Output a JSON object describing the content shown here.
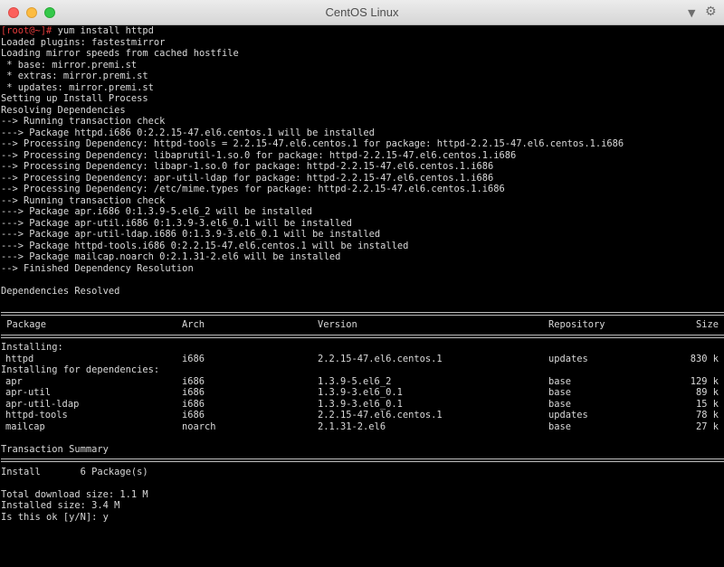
{
  "window": {
    "title": "CentOS Linux"
  },
  "terminal": {
    "prompt": "[root@~]# ",
    "command": "yum install httpd",
    "log": [
      "Loaded plugins: fastestmirror",
      "Loading mirror speeds from cached hostfile",
      " * base: mirror.premi.st",
      " * extras: mirror.premi.st",
      " * updates: mirror.premi.st",
      "Setting up Install Process",
      "Resolving Dependencies",
      "--> Running transaction check",
      "---> Package httpd.i686 0:2.2.15-47.el6.centos.1 will be installed",
      "--> Processing Dependency: httpd-tools = 2.2.15-47.el6.centos.1 for package: httpd-2.2.15-47.el6.centos.1.i686",
      "--> Processing Dependency: libaprutil-1.so.0 for package: httpd-2.2.15-47.el6.centos.1.i686",
      "--> Processing Dependency: libapr-1.so.0 for package: httpd-2.2.15-47.el6.centos.1.i686",
      "--> Processing Dependency: apr-util-ldap for package: httpd-2.2.15-47.el6.centos.1.i686",
      "--> Processing Dependency: /etc/mime.types for package: httpd-2.2.15-47.el6.centos.1.i686",
      "--> Running transaction check",
      "---> Package apr.i686 0:1.3.9-5.el6_2 will be installed",
      "---> Package apr-util.i686 0:1.3.9-3.el6_0.1 will be installed",
      "---> Package apr-util-ldap.i686 0:1.3.9-3.el6_0.1 will be installed",
      "---> Package httpd-tools.i686 0:2.2.15-47.el6.centos.1 will be installed",
      "---> Package mailcap.noarch 0:2.1.31-2.el6 will be installed",
      "--> Finished Dependency Resolution",
      "",
      "Dependencies Resolved",
      ""
    ],
    "table": {
      "headers": {
        "package": " Package",
        "arch": "Arch",
        "version": "Version",
        "repository": "Repository",
        "size": "Size"
      },
      "installing_label": "Installing:",
      "installing": [
        {
          "package": "httpd",
          "arch": "i686",
          "version": "2.2.15-47.el6.centos.1",
          "repository": "updates",
          "size": "830 k"
        }
      ],
      "deps_label": "Installing for dependencies:",
      "deps": [
        {
          "package": "apr",
          "arch": "i686",
          "version": "1.3.9-5.el6_2",
          "repository": "base",
          "size": "129 k"
        },
        {
          "package": "apr-util",
          "arch": "i686",
          "version": "1.3.9-3.el6_0.1",
          "repository": "base",
          "size": "89 k"
        },
        {
          "package": "apr-util-ldap",
          "arch": "i686",
          "version": "1.3.9-3.el6_0.1",
          "repository": "base",
          "size": "15 k"
        },
        {
          "package": "httpd-tools",
          "arch": "i686",
          "version": "2.2.15-47.el6.centos.1",
          "repository": "updates",
          "size": "78 k"
        },
        {
          "package": "mailcap",
          "arch": "noarch",
          "version": "2.1.31-2.el6",
          "repository": "base",
          "size": "27 k"
        }
      ]
    },
    "summary": {
      "heading": "Transaction Summary",
      "install_line": "Install       6 Package(s)",
      "download_size": "Total download size: 1.1 M",
      "installed_size": "Installed size: 3.4 M",
      "confirm_prompt": "Is this ok [y/N]: ",
      "confirm_answer": "y"
    }
  }
}
